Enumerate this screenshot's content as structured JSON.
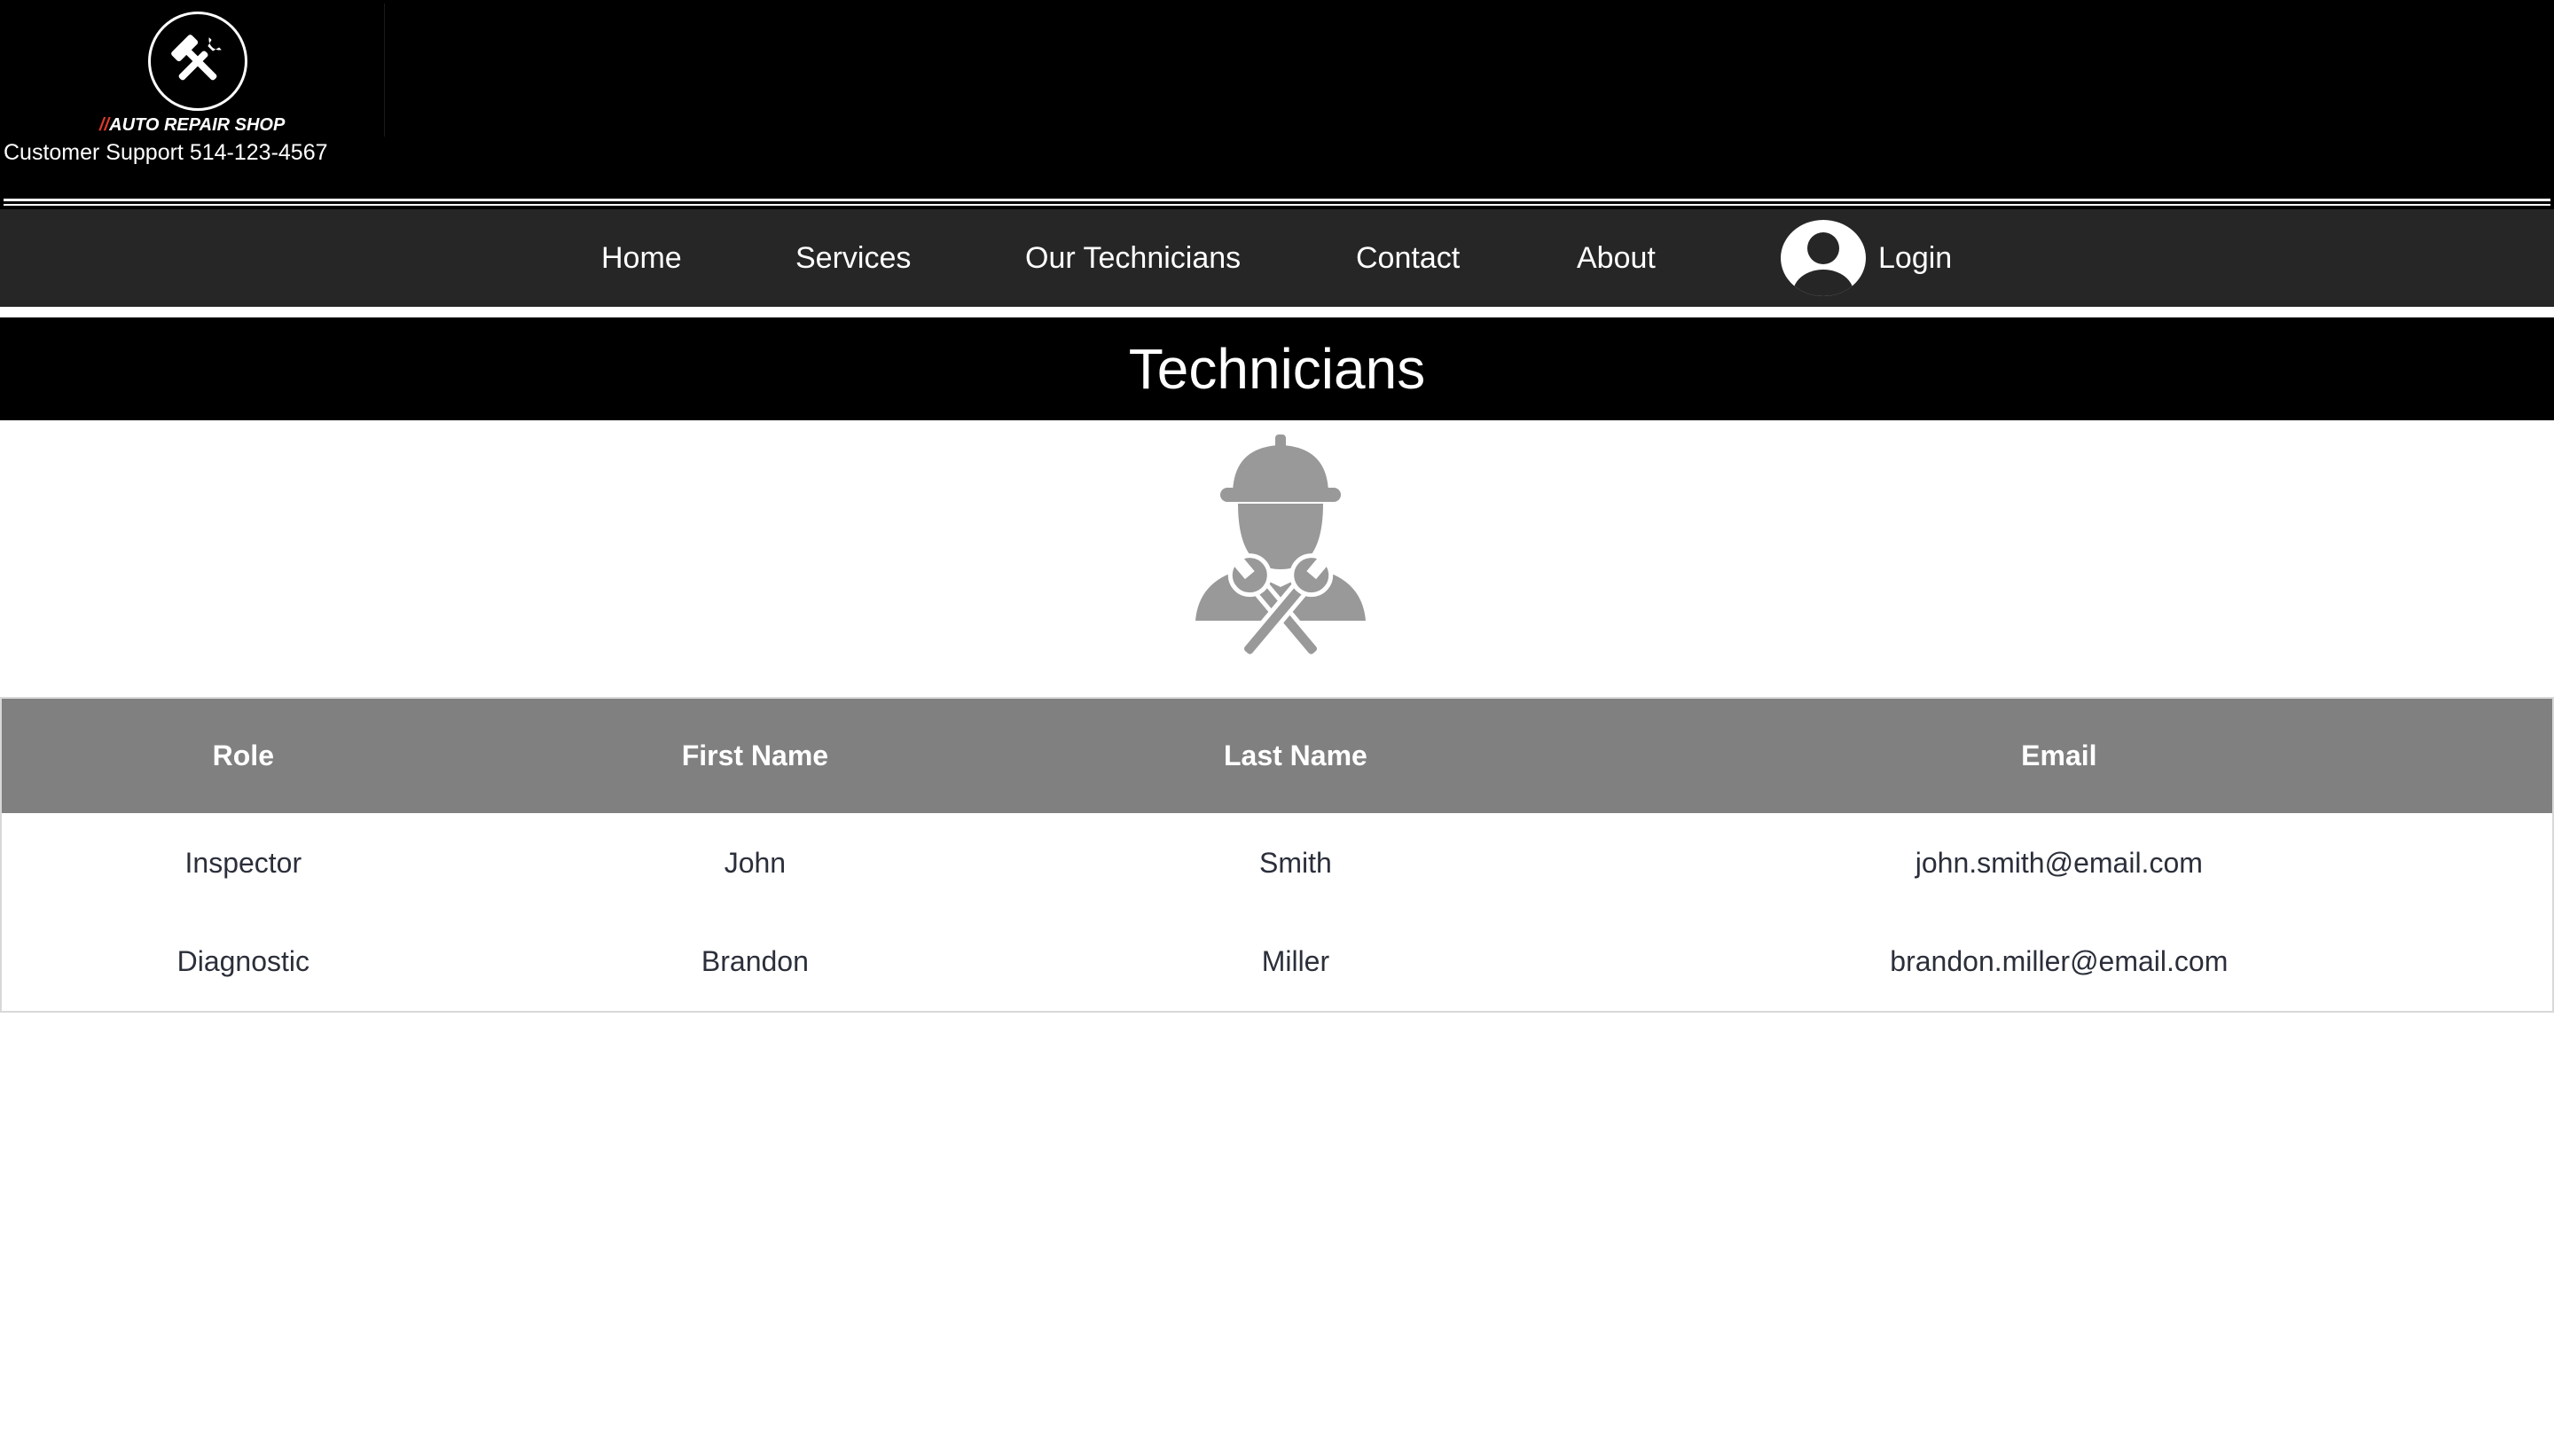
{
  "header": {
    "logo_text": "AUTO REPAIR SHOP",
    "logo_slash": "//",
    "support": "Customer Support 514-123-4567"
  },
  "nav": {
    "items": [
      "Home",
      "Services",
      "Our Technicians",
      "Contact",
      "About"
    ],
    "login": "Login"
  },
  "page": {
    "title": "Technicians"
  },
  "table": {
    "headers": [
      "Role",
      "First Name",
      "Last Name",
      "Email"
    ],
    "rows": [
      [
        "Inspector",
        "John",
        "Smith",
        "john.smith@email.com"
      ],
      [
        "Diagnostic",
        "Brandon",
        "Miller",
        "brandon.miller@email.com"
      ]
    ]
  },
  "icons": {
    "logo": "crossed-hammer-wrench-icon",
    "avatar": "user-avatar-icon",
    "illustration": "technician-hardhat-icon"
  },
  "colors": {
    "header_bg": "#000000",
    "nav_bg": "#262626",
    "table_header_bg": "#808080",
    "accent_slash": "#e03a2c",
    "illustration": "#999999"
  }
}
